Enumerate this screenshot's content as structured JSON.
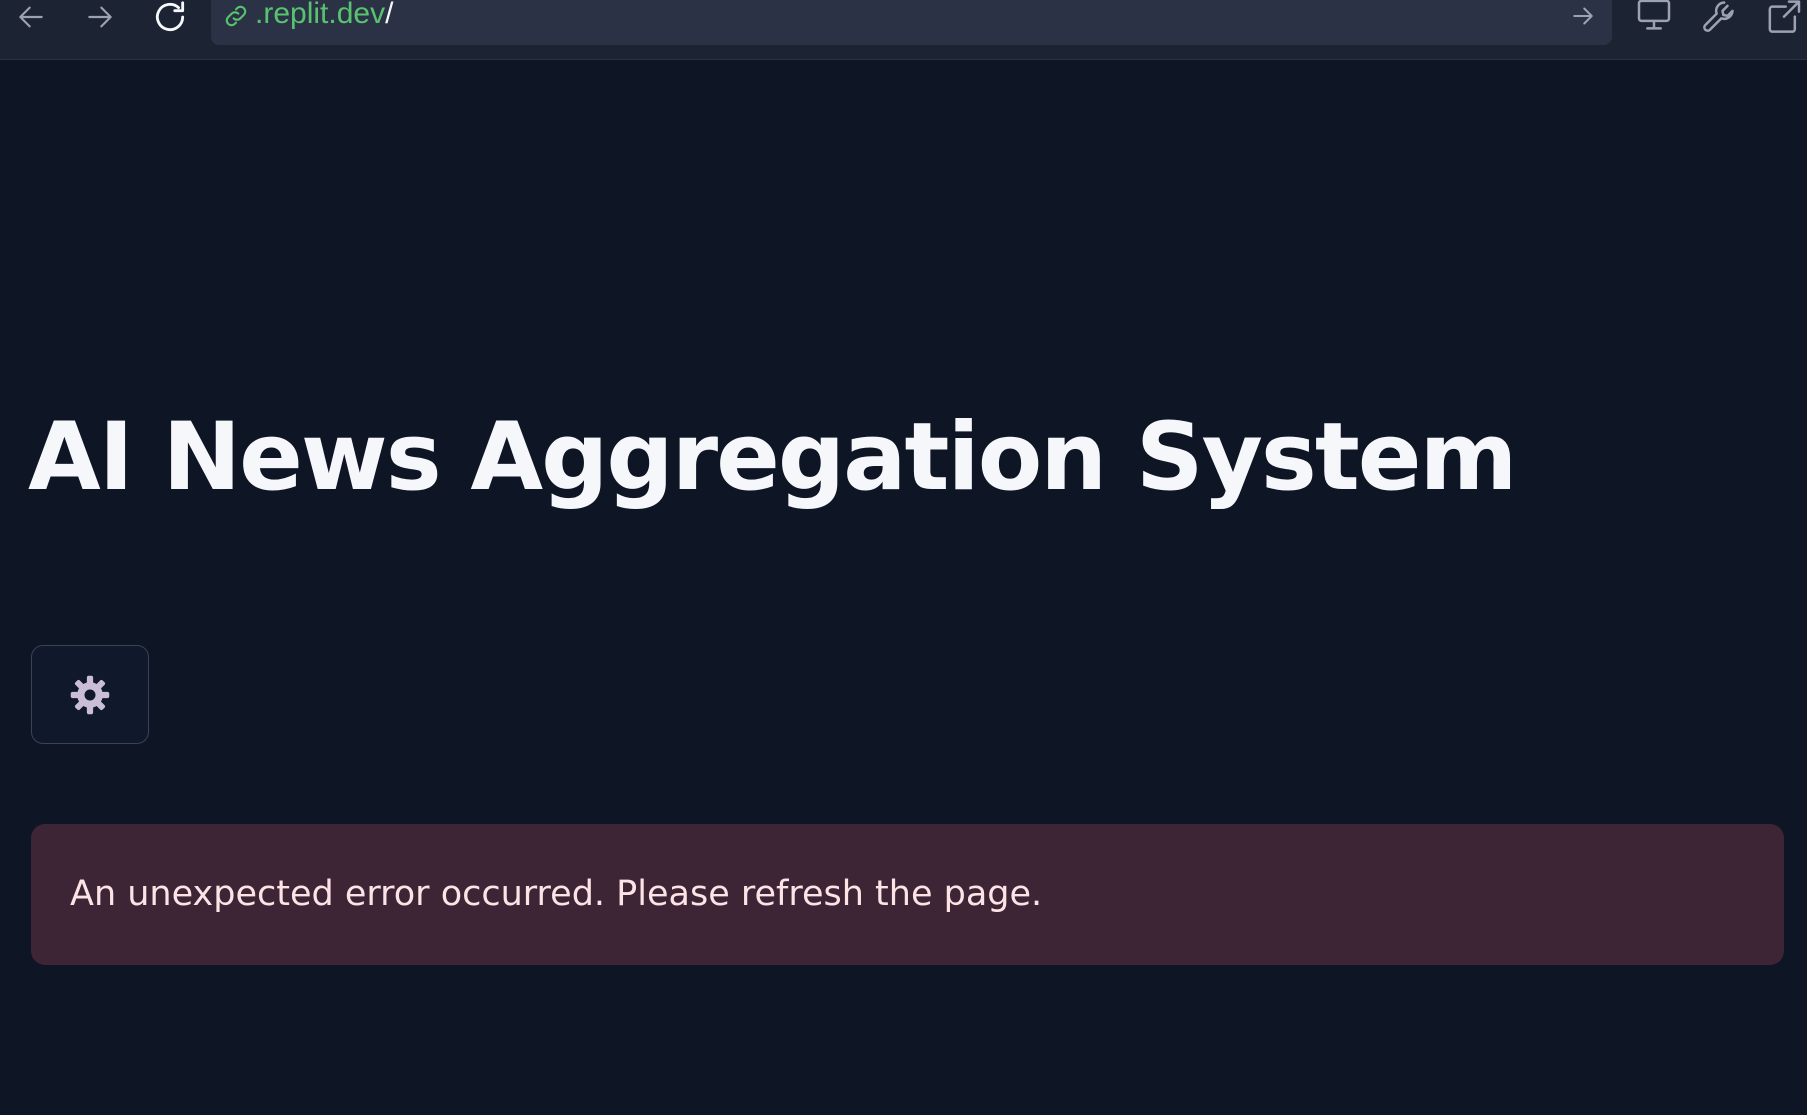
{
  "browser": {
    "url_domain": ".replit.dev",
    "url_path": "/",
    "icons": {
      "back": "arrow-left-icon",
      "forward": "arrow-right-icon",
      "reload": "reload-icon",
      "link": "link-icon",
      "go": "arrow-right-icon",
      "devices": "monitor-icon",
      "tools": "wrench-icon",
      "external": "external-link-icon"
    },
    "colors": {
      "bar": "#1c2333",
      "url_field": "#2b3245",
      "url_domain": "#58c36f"
    }
  },
  "app": {
    "title": "AI News Aggregation System",
    "settings_icon": "gear-icon",
    "error_message": "An unexpected error occurred. Please refresh the page.",
    "colors": {
      "background": "#0e1525",
      "error_bg": "#3e2535",
      "error_text": "#fde2e6",
      "gear": "#c9bdd8"
    }
  }
}
